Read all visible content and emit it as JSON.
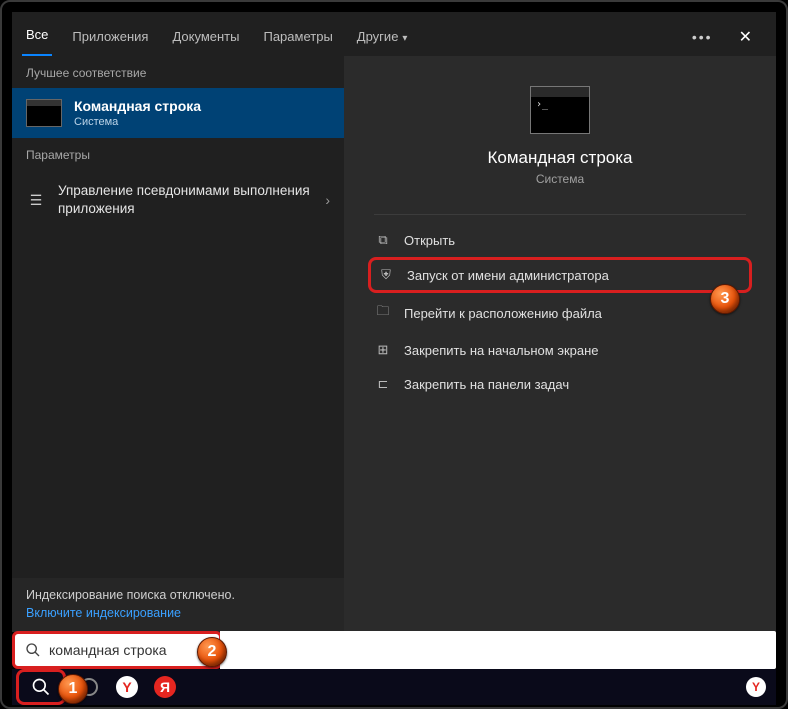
{
  "tabs": {
    "all": "Все",
    "apps": "Приложения",
    "docs": "Документы",
    "params": "Параметры",
    "others": "Другие"
  },
  "sections": {
    "best_match": "Лучшее соответствие",
    "parameters": "Параметры"
  },
  "best": {
    "title": "Командная строка",
    "subtitle": "Система"
  },
  "param_item": {
    "text": "Управление псевдонимами выполнения приложения"
  },
  "indexing": {
    "off_text": "Индексирование поиска отключено.",
    "enable_link": "Включите индексирование"
  },
  "preview": {
    "title": "Командная строка",
    "subtitle": "Система"
  },
  "actions": {
    "open": "Открыть",
    "run_admin": "Запуск от имени администратора",
    "open_location": "Перейти к расположению файла",
    "pin_start": "Закрепить на начальном экране",
    "pin_taskbar": "Закрепить на панели задач"
  },
  "search": {
    "query": "командная строка"
  },
  "badges": {
    "b1": "1",
    "b2": "2",
    "b3": "3"
  }
}
